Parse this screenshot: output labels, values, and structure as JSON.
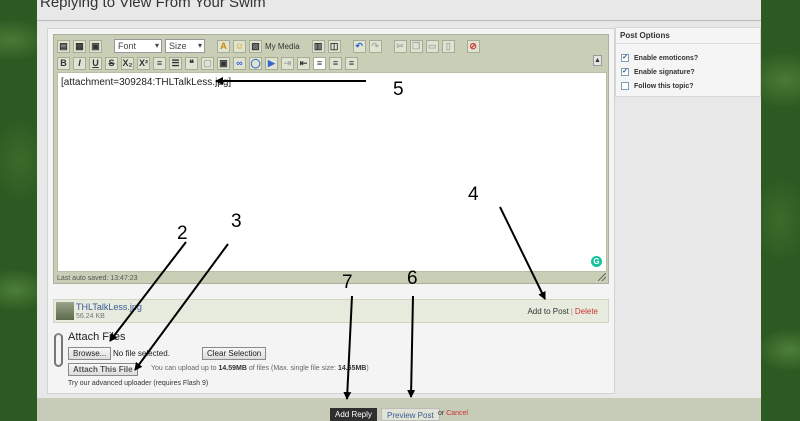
{
  "page": {
    "title": "Replying to View From Your Swim"
  },
  "editor": {
    "toolbar1": {
      "font_label": "Font",
      "size_label": "Size",
      "my_media_label": "My Media"
    },
    "toolbar2": {
      "bold": "B",
      "italic": "I",
      "underline": "U",
      "strike": "S",
      "subscript": "X₂",
      "superscript": "X²"
    },
    "content": "[attachment=309284:THLTalkLess.jpg]",
    "autosave": "Last auto saved: 13:47:23",
    "grammarly": "G"
  },
  "attachment": {
    "name": "THLTalkLess.jpg",
    "size": "56.24 KB",
    "add_to_post": "Add to Post",
    "separator": "|",
    "delete": "Delete"
  },
  "attach_files": {
    "heading": "Attach Files",
    "browse_label": "Browse...",
    "no_file": "No file selected.",
    "clear_label": "Clear Selection",
    "attach_label": "Attach This File",
    "note_prefix": "You can upload up to",
    "note_total": "14.59MB",
    "note_middle": "of files (Max. single file size:",
    "note_single": "14.65MB",
    "note_suffix": ")",
    "advanced": "Try our advanced uploader (requires Flash 9)"
  },
  "post_options": {
    "title": "Post Options",
    "items": [
      {
        "label": "Enable emoticons?",
        "checked": true,
        "mark": "✓"
      },
      {
        "label": "Enable signature?",
        "checked": true,
        "mark": "✓"
      },
      {
        "label": "Follow this topic?",
        "checked": false,
        "mark": ""
      }
    ]
  },
  "actions": {
    "add_reply": "Add Reply",
    "preview": "Preview Post",
    "or": "or",
    "cancel": "Cancel"
  },
  "annotations": [
    "2",
    "3",
    "4",
    "5",
    "6",
    "7"
  ],
  "colors": {
    "background": "#2d5a22",
    "editor_frame": "#c9cfb6",
    "add_reply": "#2f2f2f",
    "delete_link": "#cc3333",
    "link": "#3b5998"
  }
}
